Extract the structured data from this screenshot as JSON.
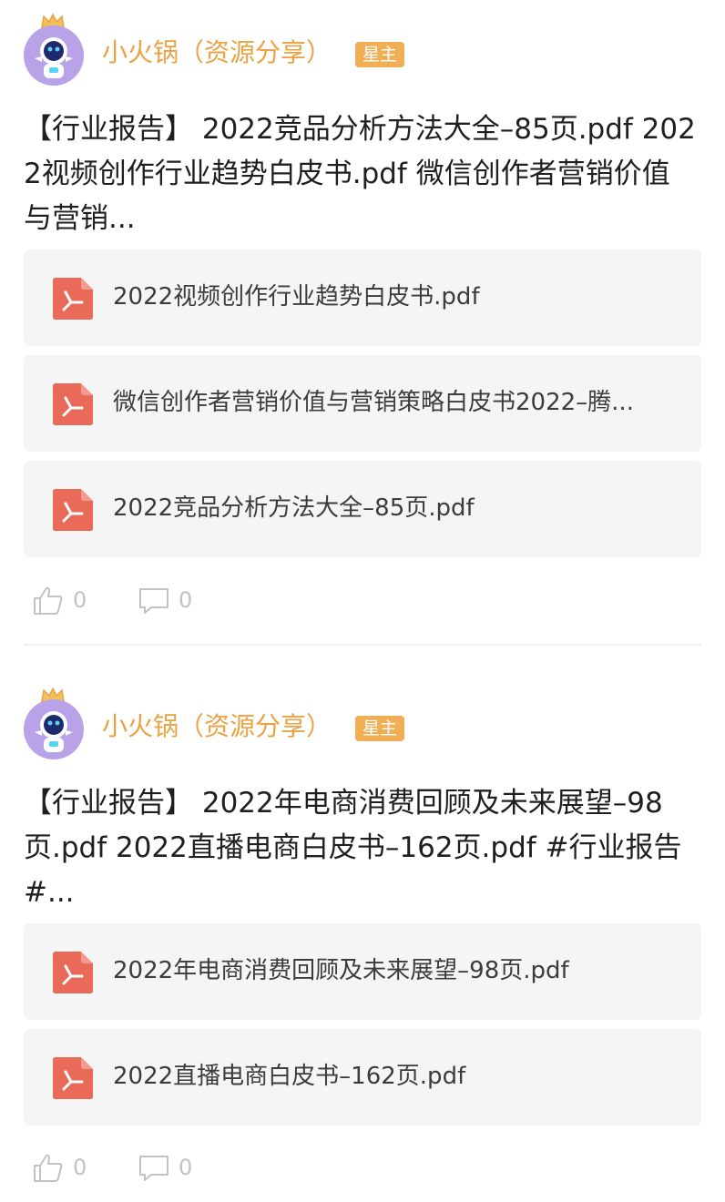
{
  "posts": [
    {
      "author": "小火锅（资源分享）",
      "badge": "星主",
      "text": "【行业报告】 2022竞品分析方法大全–85页.pdf 2022视频创作行业趋势白皮书.pdf 微信创作者营销价值与营销...",
      "files": [
        {
          "name": "2022视频创作行业趋势白皮书.pdf"
        },
        {
          "name": "微信创作者营销价值与营销策略白皮书2022–腾..."
        },
        {
          "name": "2022竞品分析方法大全–85页.pdf"
        }
      ],
      "likes": "0",
      "comments": "0"
    },
    {
      "author": "小火锅（资源分享）",
      "badge": "星主",
      "text": "【行业报告】 2022年电商消费回顾及未来展望–98页.pdf 2022直播电商白皮书–162页.pdf #行业报告#...",
      "files": [
        {
          "name": "2022年电商消费回顾及未来展望–98页.pdf"
        },
        {
          "name": "2022直播电商白皮书–162页.pdf"
        }
      ],
      "likes": "0",
      "comments": "0"
    }
  ],
  "colors": {
    "author": "#e9a344",
    "badge_bg": "#f0ae55",
    "file_card_bg": "#f5f5f5",
    "pdf_icon": "#ea6a5a",
    "action_gray": "#c2c2c2"
  },
  "icons": {
    "crown": "crown-icon",
    "pdf": "pdf-icon",
    "like": "thumbs-up-icon",
    "comment": "comment-icon"
  }
}
